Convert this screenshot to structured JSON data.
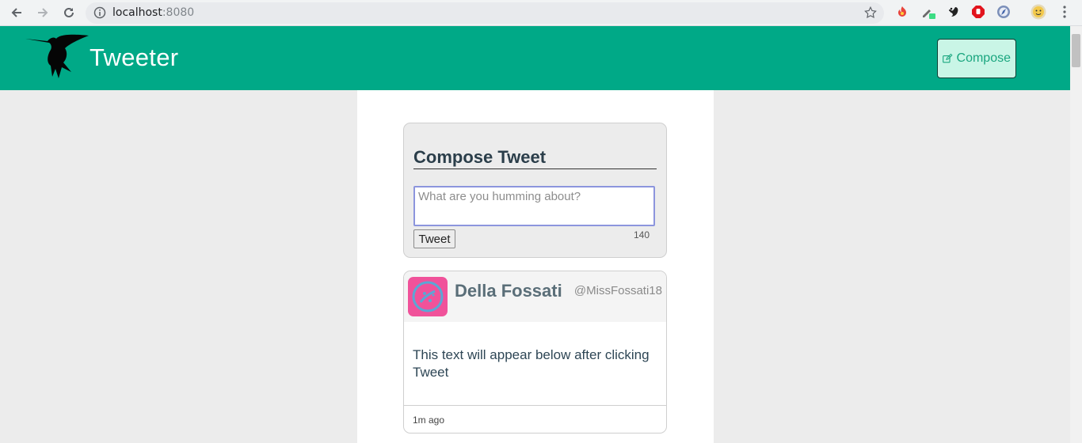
{
  "browser": {
    "url_host": "localhost",
    "url_port": ":8080"
  },
  "header": {
    "title": "Tweeter",
    "compose_label": "Compose",
    "brand_color": "#00a987"
  },
  "compose": {
    "title": "Compose Tweet",
    "placeholder": "What are you humming about?",
    "value": "",
    "submit_label": "Tweet",
    "counter": "140"
  },
  "tweets": [
    {
      "author": "Della Fossati",
      "handle": "@MissFossati18",
      "body": "This text will appear below after clicking Tweet",
      "time": "1m ago"
    }
  ]
}
